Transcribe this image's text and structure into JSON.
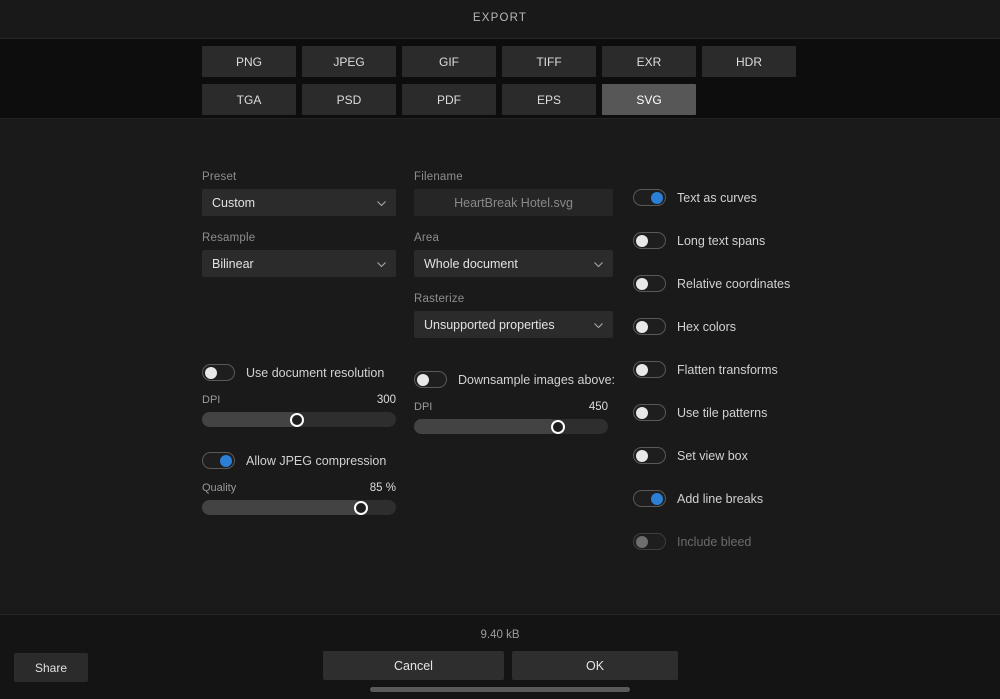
{
  "window": {
    "title": "EXPORT"
  },
  "formats": {
    "row1": [
      {
        "label": "PNG",
        "selected": false
      },
      {
        "label": "JPEG",
        "selected": false
      },
      {
        "label": "GIF",
        "selected": false
      },
      {
        "label": "TIFF",
        "selected": false
      },
      {
        "label": "EXR",
        "selected": false
      },
      {
        "label": "HDR",
        "selected": false
      }
    ],
    "row2": [
      {
        "label": "TGA",
        "selected": false
      },
      {
        "label": "PSD",
        "selected": false
      },
      {
        "label": "PDF",
        "selected": false
      },
      {
        "label": "EPS",
        "selected": false
      },
      {
        "label": "SVG",
        "selected": true
      }
    ]
  },
  "left_column": {
    "preset": {
      "label": "Preset",
      "value": "Custom",
      "icon": "chevron-down-icon"
    },
    "resample": {
      "label": "Resample",
      "value": "Bilinear",
      "icon": "chevron-down-icon"
    },
    "use_document_resolution": {
      "label": "Use document resolution",
      "on": false
    },
    "dpi": {
      "label": "DPI",
      "value": "300",
      "percent": 49
    },
    "allow_jpeg_compression": {
      "label": "Allow JPEG compression",
      "on": true
    },
    "quality": {
      "label": "Quality",
      "value": "85 %",
      "percent": 82
    }
  },
  "mid_column": {
    "filename": {
      "label": "Filename",
      "value": "HeartBreak Hotel.svg"
    },
    "area": {
      "label": "Area",
      "value": "Whole document",
      "icon": "chevron-down-icon"
    },
    "rasterize": {
      "label": "Rasterize",
      "value": "Unsupported properties",
      "icon": "chevron-down-icon"
    },
    "downsample_images_above": {
      "label": "Downsample images above:",
      "on": false
    },
    "dpi": {
      "label": "DPI",
      "value": "450",
      "percent": 74
    }
  },
  "right_column": {
    "options": [
      {
        "label": "Text as curves",
        "on": true,
        "disabled": false
      },
      {
        "label": "Long text spans",
        "on": false,
        "disabled": false
      },
      {
        "label": "Relative coordinates",
        "on": false,
        "disabled": false
      },
      {
        "label": "Hex colors",
        "on": false,
        "disabled": false
      },
      {
        "label": "Flatten transforms",
        "on": false,
        "disabled": false
      },
      {
        "label": "Use tile patterns",
        "on": false,
        "disabled": false
      },
      {
        "label": "Set view box",
        "on": false,
        "disabled": false
      },
      {
        "label": "Add line breaks",
        "on": true,
        "disabled": false
      },
      {
        "label": "Include bleed",
        "on": false,
        "disabled": true
      }
    ]
  },
  "footer": {
    "filesize": "9.40 kB",
    "share_label": "Share",
    "cancel_label": "Cancel",
    "ok_label": "OK"
  },
  "colors": {
    "accent": "#2b7fd4",
    "selected_format": "#575757",
    "background": "#1a1a1a"
  }
}
